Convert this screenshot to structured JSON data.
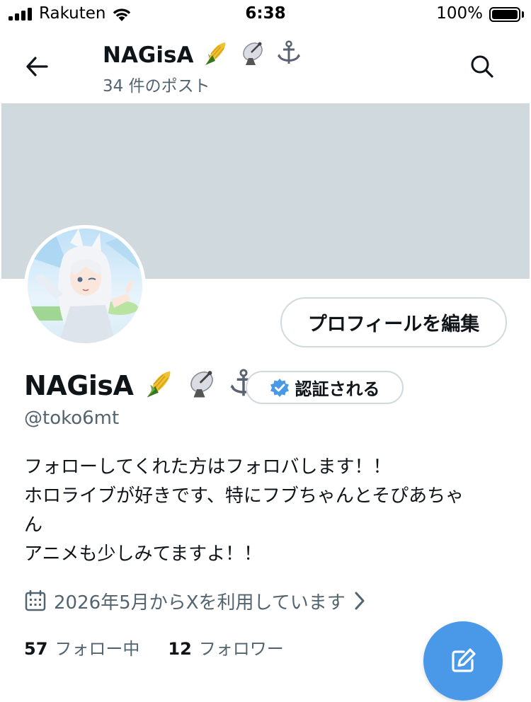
{
  "status_bar": {
    "carrier": "Rakuten",
    "time": "6:38",
    "battery_percent": "100%"
  },
  "header": {
    "title": "NAGisA",
    "post_count": "34 件のポスト"
  },
  "profile": {
    "name": "NAGisA",
    "name_emojis": [
      "corn-emoji",
      "satellite-antenna-emoji",
      "anchor-emoji"
    ],
    "handle": "@toko6mt",
    "edit_profile_label": "プロフィールを編集",
    "verify_label": "認証される",
    "bio_lines": [
      "フォローしてくれた方はフォロバします！！",
      "ホロライブが好きです、特にフブちゃんとそぴあちゃ",
      "ん",
      "アニメも少しみてますよ！！"
    ],
    "joined": "2026年5月からXを利用しています",
    "following_count": "57",
    "following_label": "フォロー中",
    "followers_count": "12",
    "followers_label": "フォロワー"
  },
  "colors": {
    "banner": "#cfd9de",
    "accent": "#4a99e9",
    "secondary_text": "#536471",
    "primary_text": "#0f1419"
  }
}
